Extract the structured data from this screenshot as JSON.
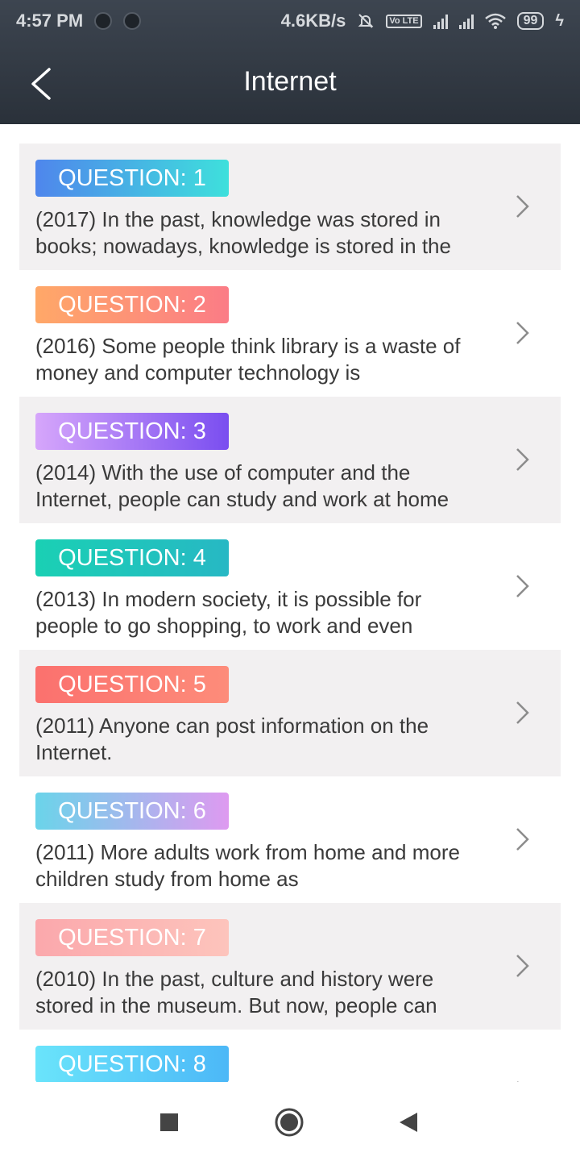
{
  "status_bar": {
    "time": "4:57 PM",
    "speed": "4.6KB/s",
    "lte": "Vo LTE",
    "battery": "99"
  },
  "header": {
    "title": "Internet"
  },
  "questions": [
    {
      "badge": "QUESTION: 1",
      "text": "(2017) In the past, knowledge was stored in books; nowadays, knowledge is stored in the",
      "gradient_from": "#4f86ec",
      "gradient_to": "#3ee0dc"
    },
    {
      "badge": "QUESTION: 2",
      "text": "(2016) Some people think library is a waste of money and computer technology is",
      "gradient_from": "#ffa868",
      "gradient_to": "#fb7c86"
    },
    {
      "badge": "QUESTION: 3",
      "text": "(2014) With the use of computer and the Internet, people can study and work at home",
      "gradient_from": "#d6a6fb",
      "gradient_to": "#7a4ef0"
    },
    {
      "badge": "QUESTION: 4",
      "text": "(2013) In modern society, it is possible for people to go shopping, to work and even",
      "gradient_from": "#1ad0b4",
      "gradient_to": "#27b8c4"
    },
    {
      "badge": "QUESTION: 5",
      "text": "(2011) Anyone can post information on the Internet.",
      "gradient_from": "#fb716e",
      "gradient_to": "#fd8c7a"
    },
    {
      "badge": "QUESTION: 6",
      "text": "(2011) More adults work from home and more children study from home as",
      "gradient_from": "#6ad4ea",
      "gradient_to": "#de9af0"
    },
    {
      "badge": "QUESTION: 7",
      "text": "(2010) In the past, culture and history were stored in the museum. But now, people can",
      "gradient_from": "#fba8ac",
      "gradient_to": "#fdc4bc"
    },
    {
      "badge": "QUESTION: 8",
      "text": "",
      "gradient_from": "#6ae4fb",
      "gradient_to": "#4cb8f7"
    }
  ]
}
